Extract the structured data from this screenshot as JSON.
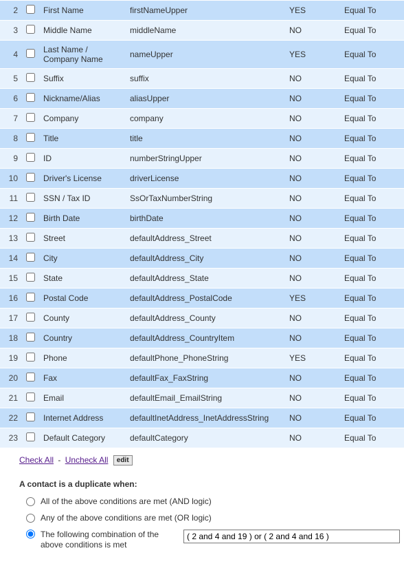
{
  "rows": [
    {
      "num": "2",
      "label": "First Name",
      "field": "firstNameUpper",
      "yn": "YES",
      "op": "Equal To"
    },
    {
      "num": "3",
      "label": "Middle Name",
      "field": "middleName",
      "yn": "NO",
      "op": "Equal To"
    },
    {
      "num": "4",
      "label": "Last Name / Company Name",
      "field": "nameUpper",
      "yn": "YES",
      "op": "Equal To"
    },
    {
      "num": "5",
      "label": "Suffix",
      "field": "suffix",
      "yn": "NO",
      "op": "Equal To"
    },
    {
      "num": "6",
      "label": "Nickname/Alias",
      "field": "aliasUpper",
      "yn": "NO",
      "op": "Equal To"
    },
    {
      "num": "7",
      "label": "Company",
      "field": "company",
      "yn": "NO",
      "op": "Equal To"
    },
    {
      "num": "8",
      "label": "Title",
      "field": "title",
      "yn": "NO",
      "op": "Equal To"
    },
    {
      "num": "9",
      "label": "ID",
      "field": "numberStringUpper",
      "yn": "NO",
      "op": "Equal To"
    },
    {
      "num": "10",
      "label": "Driver's License",
      "field": "driverLicense",
      "yn": "NO",
      "op": "Equal To"
    },
    {
      "num": "11",
      "label": "SSN / Tax ID",
      "field": "SsOrTaxNumberString",
      "yn": "NO",
      "op": "Equal To"
    },
    {
      "num": "12",
      "label": "Birth Date",
      "field": "birthDate",
      "yn": "NO",
      "op": "Equal To"
    },
    {
      "num": "13",
      "label": "Street",
      "field": "defaultAddress_Street",
      "yn": "NO",
      "op": "Equal To"
    },
    {
      "num": "14",
      "label": "City",
      "field": "defaultAddress_City",
      "yn": "NO",
      "op": "Equal To"
    },
    {
      "num": "15",
      "label": "State",
      "field": "defaultAddress_State",
      "yn": "NO",
      "op": "Equal To"
    },
    {
      "num": "16",
      "label": "Postal Code",
      "field": "defaultAddress_PostalCode",
      "yn": "YES",
      "op": "Equal To"
    },
    {
      "num": "17",
      "label": "County",
      "field": "defaultAddress_County",
      "yn": "NO",
      "op": "Equal To"
    },
    {
      "num": "18",
      "label": "Country",
      "field": "defaultAddress_CountryItem",
      "yn": "NO",
      "op": "Equal To"
    },
    {
      "num": "19",
      "label": "Phone",
      "field": "defaultPhone_PhoneString",
      "yn": "YES",
      "op": "Equal To"
    },
    {
      "num": "20",
      "label": "Fax",
      "field": "defaultFax_FaxString",
      "yn": "NO",
      "op": "Equal To"
    },
    {
      "num": "21",
      "label": "Email",
      "field": "defaultEmail_EmailString",
      "yn": "NO",
      "op": "Equal To"
    },
    {
      "num": "22",
      "label": "Internet Address",
      "field": "defaultInetAddress_InetAddressString",
      "yn": "NO",
      "op": "Equal To"
    },
    {
      "num": "23",
      "label": "Default Category",
      "field": "defaultCategory",
      "yn": "NO",
      "op": "Equal To"
    }
  ],
  "controls": {
    "check_all": "Check All",
    "uncheck_all": "Uncheck All",
    "dash": " - ",
    "edit": "edit"
  },
  "dup": {
    "heading": "A contact is a duplicate when:",
    "opt_and": "All of the above conditions are met (AND logic)",
    "opt_or": "Any of the above conditions are met (OR logic)",
    "opt_combo": "The following combination of the above conditions is met",
    "combo_value": "( 2 and 4 and 19 ) or ( 2 and 4 and 16 )"
  }
}
